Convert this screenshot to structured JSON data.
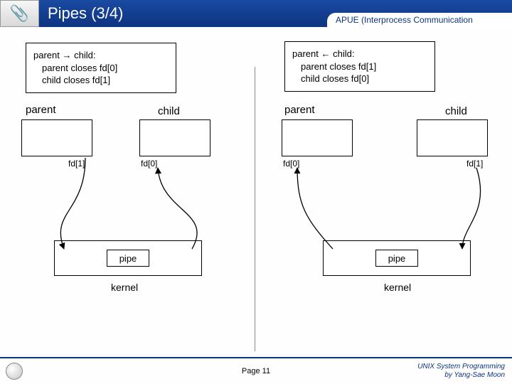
{
  "header": {
    "title": "Pipes (3/4)",
    "subtitle": "APUE (Interprocess Communication"
  },
  "left": {
    "desc_line1": "parent → child:",
    "desc_line2": "parent closes fd[0]",
    "desc_line3": "child closes fd[1]",
    "parent_label": "parent",
    "child_label": "child",
    "parent_fd": "fd[1]",
    "child_fd": "fd[0]",
    "pipe_label": "pipe",
    "kernel_label": "kernel"
  },
  "right": {
    "desc_line1": "parent ← child:",
    "desc_line2": "parent closes fd[1]",
    "desc_line3": "child closes fd[0]",
    "parent_label": "parent",
    "child_label": "child",
    "parent_fd": "fd[0]",
    "child_fd": "fd[1]",
    "pipe_label": "pipe",
    "kernel_label": "kernel"
  },
  "footer": {
    "page": "Page 11",
    "credit_line1": "UNIX System Programming",
    "credit_line2": "by Yang-Sae Moon"
  }
}
